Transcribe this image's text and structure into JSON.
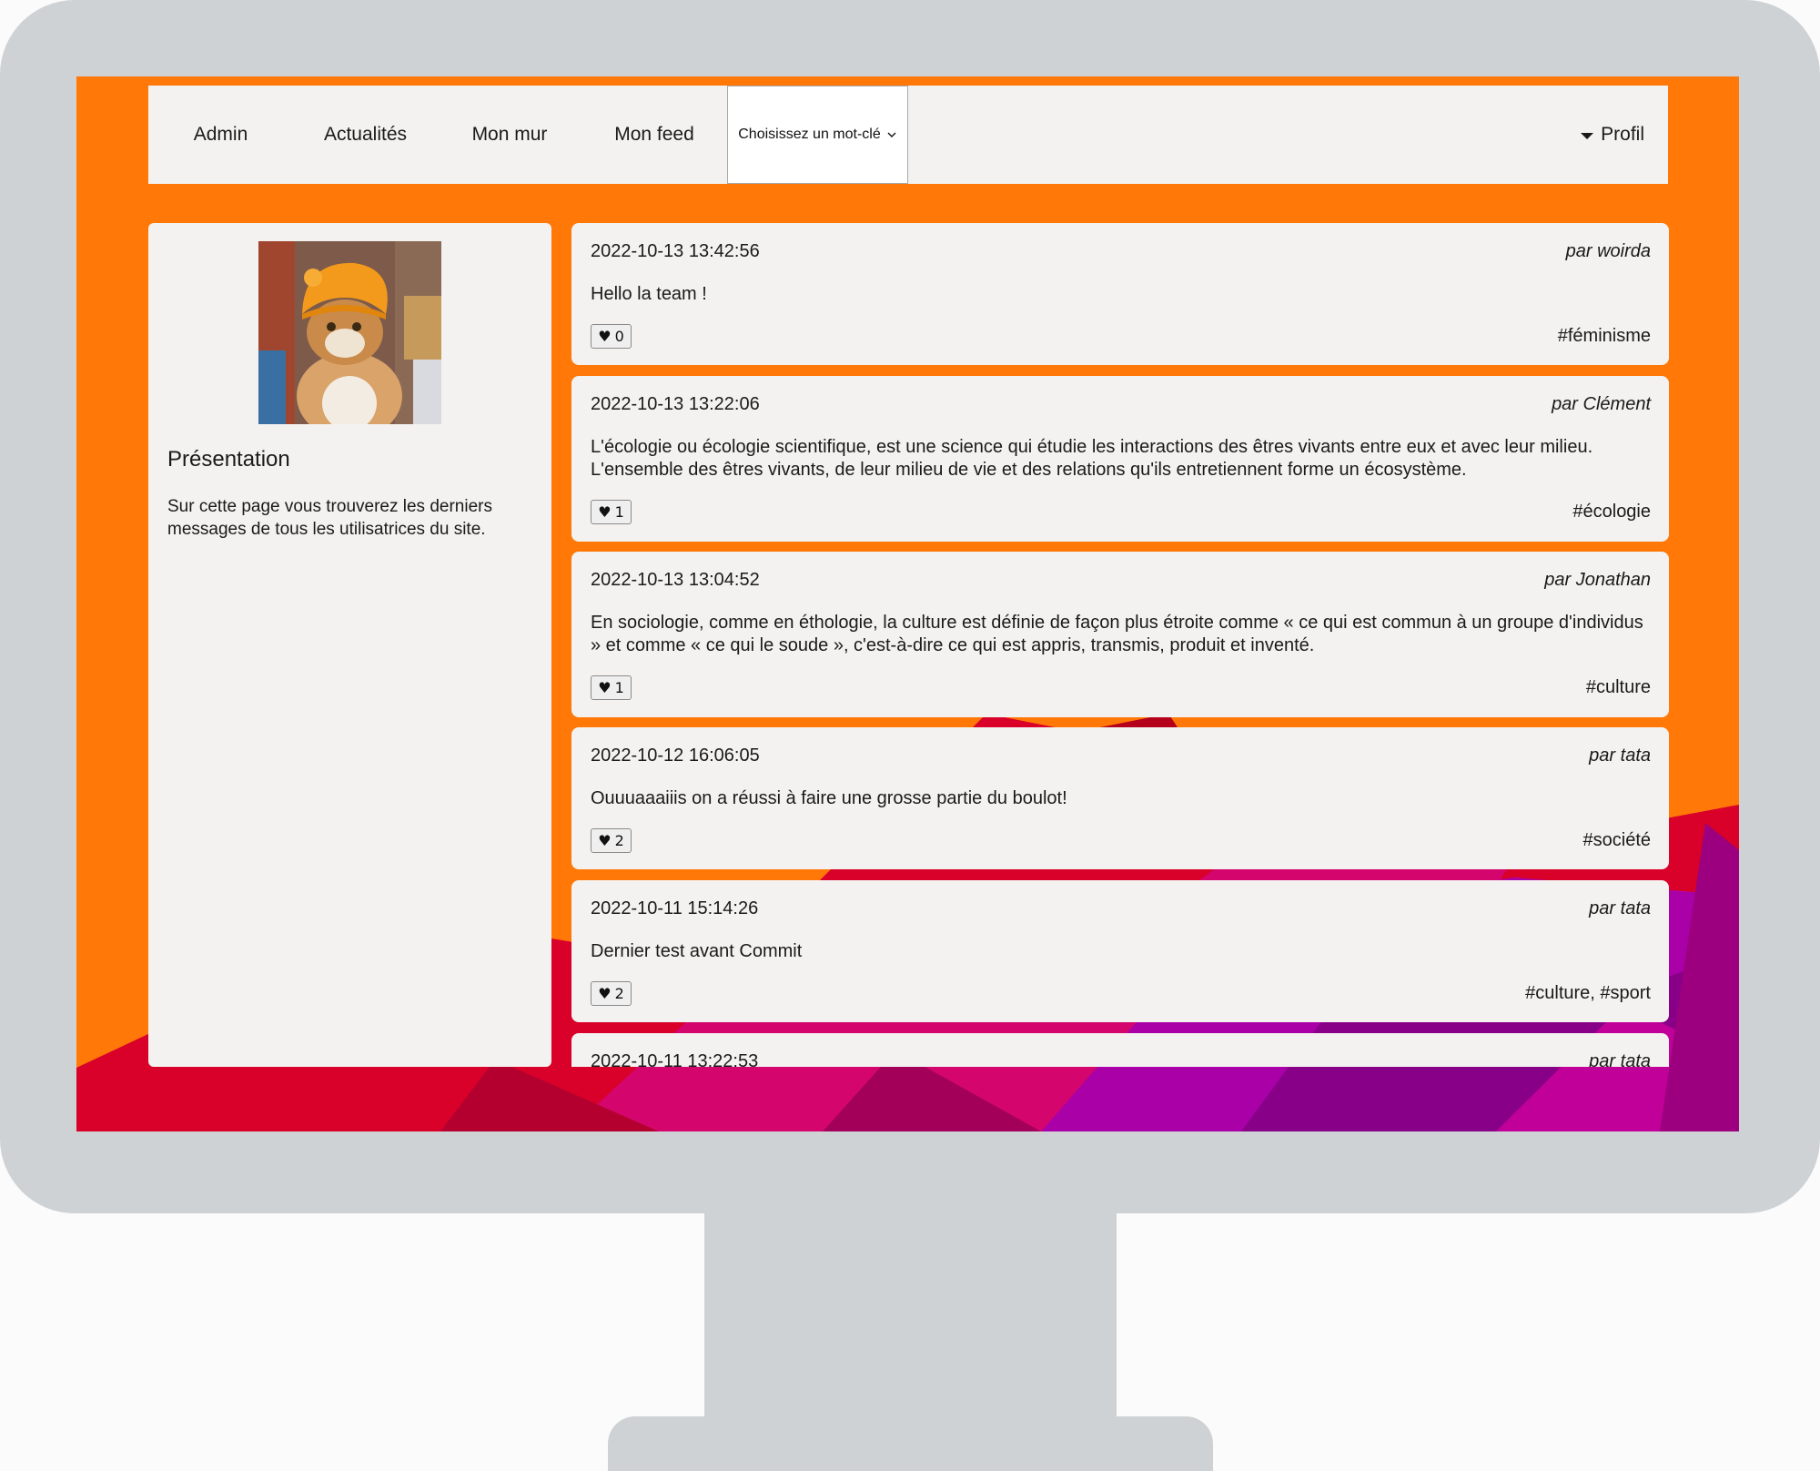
{
  "colors": {
    "screen_bg": "#ff7808",
    "card_bg": "#f3f2f0",
    "monitor": "#ced2d5"
  },
  "nav": {
    "items": [
      {
        "label": "Admin"
      },
      {
        "label": "Actualités"
      },
      {
        "label": "Mon mur"
      },
      {
        "label": "Mon feed"
      }
    ],
    "keyword_select": "Choisissez un mot-clé",
    "profile": "Profil"
  },
  "sidebar": {
    "avatar_icon": "cat-photo-avatar",
    "title": "Présentation",
    "text": "Sur cette page vous trouverez les derniers messages de tous les utilisatrices du site."
  },
  "posts": [
    {
      "date": "2022-10-13 13:42:56",
      "author": "par woirda",
      "content": "Hello la team !",
      "likes": "0",
      "tags": "#féminisme"
    },
    {
      "date": "2022-10-13 13:22:06",
      "author": "par Clément",
      "content": "L'écologie ou écologie scientifique, est une science qui étudie les interactions des êtres vivants entre eux et avec leur milieu. L'ensemble des êtres vivants, de leur milieu de vie et des relations qu'ils entretiennent forme un écosystème.",
      "likes": "1",
      "tags": "#écologie"
    },
    {
      "date": "2022-10-13 13:04:52",
      "author": "par Jonathan",
      "content": "En sociologie, comme en éthologie, la culture est définie de façon plus étroite comme « ce qui est commun à un groupe d'individus » et comme « ce qui le soude », c'est-à-dire ce qui est appris, transmis, produit et inventé.",
      "likes": "1",
      "tags": "#culture"
    },
    {
      "date": "2022-10-12 16:06:05",
      "author": "par tata",
      "content": "Ouuuaaaiiis on a réussi à faire une grosse partie du boulot!",
      "likes": "2",
      "tags": "#société"
    },
    {
      "date": "2022-10-11 15:14:26",
      "author": "par tata",
      "content": "Dernier test avant Commit",
      "likes": "2",
      "tags": "#culture, #sport"
    },
    {
      "date": "2022-10-11 13:22:53",
      "author": "par tata",
      "content": "",
      "likes": "",
      "tags": ""
    }
  ],
  "like_icon": "heart-icon"
}
